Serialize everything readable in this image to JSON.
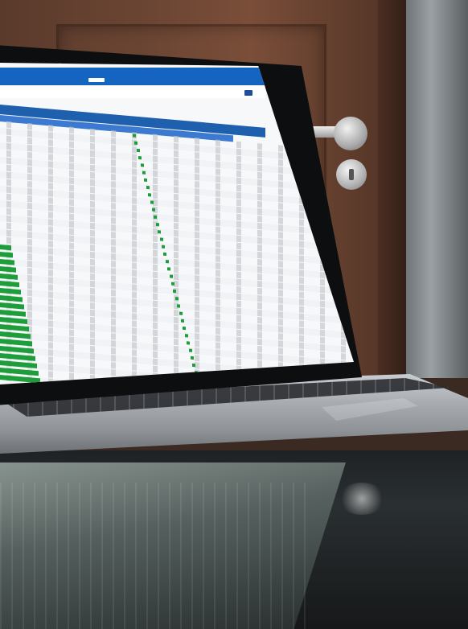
{
  "scene": {
    "description_alt": "",
    "colors": {
      "app_header": "#1565c0",
      "table_header": "#1e5fae",
      "status_green": "#1e9e3a",
      "door_wood": "#6b4533",
      "laptop_body": "#0d0e10"
    }
  },
  "icons": {
    "menu": "hamburger-menu-icon",
    "door_handle": "door-handle",
    "lock": "door-lock"
  }
}
